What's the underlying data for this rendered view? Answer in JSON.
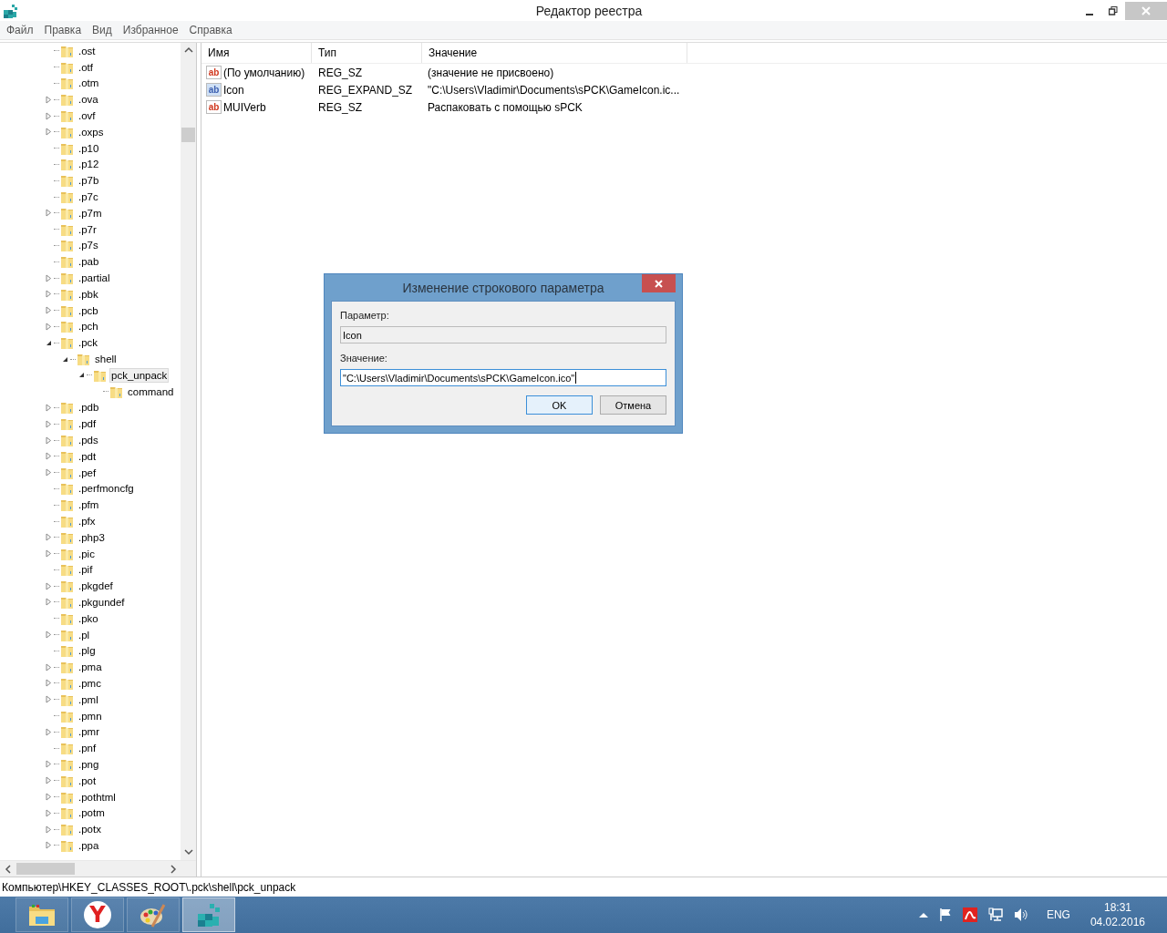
{
  "window": {
    "title": "Редактор реестра"
  },
  "menu": [
    "Файл",
    "Правка",
    "Вид",
    "Избранное",
    "Справка"
  ],
  "tree": [
    {
      "label": ".ost",
      "has_children": false,
      "selected": false
    },
    {
      "label": ".otf",
      "has_children": false,
      "selected": false
    },
    {
      "label": ".otm",
      "has_children": false,
      "selected": false
    },
    {
      "label": ".ova",
      "has_children": true,
      "expanded": false,
      "selected": false
    },
    {
      "label": ".ovf",
      "has_children": true,
      "expanded": false,
      "selected": false
    },
    {
      "label": ".oxps",
      "has_children": true,
      "expanded": false,
      "selected": false
    },
    {
      "label": ".p10",
      "has_children": false,
      "selected": false
    },
    {
      "label": ".p12",
      "has_children": false,
      "selected": false
    },
    {
      "label": ".p7b",
      "has_children": false,
      "selected": false
    },
    {
      "label": ".p7c",
      "has_children": false,
      "selected": false
    },
    {
      "label": ".p7m",
      "has_children": true,
      "expanded": false,
      "selected": false
    },
    {
      "label": ".p7r",
      "has_children": false,
      "selected": false
    },
    {
      "label": ".p7s",
      "has_children": false,
      "selected": false
    },
    {
      "label": ".pab",
      "has_children": false,
      "selected": false
    },
    {
      "label": ".partial",
      "has_children": true,
      "expanded": false,
      "selected": false
    },
    {
      "label": ".pbk",
      "has_children": true,
      "expanded": false,
      "selected": false
    },
    {
      "label": ".pcb",
      "has_children": true,
      "expanded": false,
      "selected": false
    },
    {
      "label": ".pch",
      "has_children": true,
      "expanded": false,
      "selected": false
    },
    {
      "label": ".pck",
      "has_children": true,
      "expanded": true,
      "selected": false,
      "children": [
        {
          "label": "shell",
          "has_children": true,
          "expanded": true,
          "selected": false,
          "children": [
            {
              "label": "pck_unpack",
              "has_children": true,
              "expanded": true,
              "selected": true,
              "children": [
                {
                  "label": "command",
                  "has_children": false,
                  "selected": false
                }
              ]
            }
          ]
        }
      ]
    },
    {
      "label": ".pdb",
      "has_children": true,
      "expanded": false,
      "selected": false
    },
    {
      "label": ".pdf",
      "has_children": true,
      "expanded": false,
      "selected": false
    },
    {
      "label": ".pds",
      "has_children": true,
      "expanded": false,
      "selected": false
    },
    {
      "label": ".pdt",
      "has_children": true,
      "expanded": false,
      "selected": false
    },
    {
      "label": ".pef",
      "has_children": true,
      "expanded": false,
      "selected": false
    },
    {
      "label": ".perfmoncfg",
      "has_children": false,
      "selected": false
    },
    {
      "label": ".pfm",
      "has_children": false,
      "selected": false
    },
    {
      "label": ".pfx",
      "has_children": false,
      "selected": false
    },
    {
      "label": ".php3",
      "has_children": true,
      "expanded": false,
      "selected": false
    },
    {
      "label": ".pic",
      "has_children": true,
      "expanded": false,
      "selected": false
    },
    {
      "label": ".pif",
      "has_children": false,
      "selected": false
    },
    {
      "label": ".pkgdef",
      "has_children": true,
      "expanded": false,
      "selected": false
    },
    {
      "label": ".pkgundef",
      "has_children": true,
      "expanded": false,
      "selected": false
    },
    {
      "label": ".pko",
      "has_children": false,
      "selected": false
    },
    {
      "label": ".pl",
      "has_children": true,
      "expanded": false,
      "selected": false
    },
    {
      "label": ".plg",
      "has_children": false,
      "selected": false
    },
    {
      "label": ".pma",
      "has_children": true,
      "expanded": false,
      "selected": false
    },
    {
      "label": ".pmc",
      "has_children": true,
      "expanded": false,
      "selected": false
    },
    {
      "label": ".pml",
      "has_children": true,
      "expanded": false,
      "selected": false
    },
    {
      "label": ".pmn",
      "has_children": false,
      "selected": false
    },
    {
      "label": ".pmr",
      "has_children": true,
      "expanded": false,
      "selected": false
    },
    {
      "label": ".pnf",
      "has_children": false,
      "selected": false
    },
    {
      "label": ".png",
      "has_children": true,
      "expanded": false,
      "selected": false
    },
    {
      "label": ".pot",
      "has_children": true,
      "expanded": false,
      "selected": false
    },
    {
      "label": ".pothtml",
      "has_children": true,
      "expanded": false,
      "selected": false
    },
    {
      "label": ".potm",
      "has_children": true,
      "expanded": false,
      "selected": false
    },
    {
      "label": ".potx",
      "has_children": true,
      "expanded": false,
      "selected": false
    },
    {
      "label": ".ppa",
      "has_children": true,
      "expanded": false,
      "selected": false
    }
  ],
  "values": {
    "columns": [
      "Имя",
      "Тип",
      "Значение"
    ],
    "rows": [
      {
        "kind": "sz",
        "icon_text": "ab",
        "name": "(По умолчанию)",
        "type": "REG_SZ",
        "data": "(значение не присвоено)"
      },
      {
        "kind": "expand_sz",
        "icon_text": "ab",
        "name": "Icon",
        "type": "REG_EXPAND_SZ",
        "data": "\"C:\\Users\\Vladimir\\Documents\\sPCK\\GameIcon.ic..."
      },
      {
        "kind": "sz",
        "icon_text": "ab",
        "name": "MUIVerb",
        "type": "REG_SZ",
        "data": "Распаковать с помощью sPCK"
      }
    ]
  },
  "status_bar": "Компьютер\\HKEY_CLASSES_ROOT\\.pck\\shell\\pck_unpack",
  "dialog": {
    "title": "Изменение строкового параметра",
    "name_label": "Параметр:",
    "name_value": "Icon",
    "value_label": "Значение:",
    "value": "\"C:\\Users\\Vladimir\\Documents\\sPCK\\GameIcon.ico\"",
    "ok": "OK",
    "cancel": "Отмена"
  },
  "taskbar": {
    "apps": [
      {
        "kind": "explorer",
        "active": false
      },
      {
        "kind": "browser",
        "logo_text": "Y",
        "active": false
      },
      {
        "kind": "paint",
        "active": false
      },
      {
        "kind": "regedit",
        "active": true
      }
    ],
    "language": "ENG",
    "time": "18:31",
    "date": "04.02.2016"
  }
}
